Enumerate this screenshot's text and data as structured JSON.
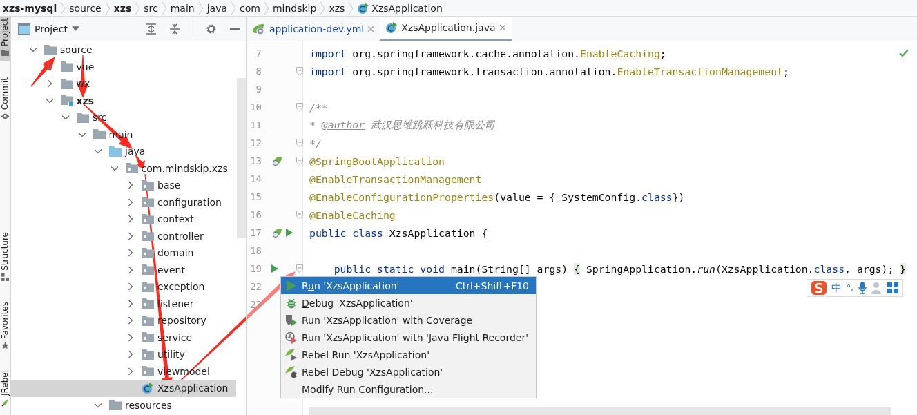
{
  "breadcrumb": [
    {
      "label": "xzs-mysql",
      "bold": true
    },
    {
      "label": "source",
      "bold": false
    },
    {
      "label": "xzs",
      "bold": true
    },
    {
      "label": "src",
      "bold": false
    },
    {
      "label": "main",
      "bold": false
    },
    {
      "label": "java",
      "bold": false
    },
    {
      "label": "com",
      "bold": false
    },
    {
      "label": "mindskip",
      "bold": false
    },
    {
      "label": "xzs",
      "bold": false
    },
    {
      "label": "XzsApplication",
      "bold": false,
      "kind": "class"
    }
  ],
  "side_tools": {
    "top": [
      {
        "label": "Project",
        "kind": "project",
        "selected": true
      },
      {
        "label": "Commit",
        "kind": "commit",
        "selected": false
      }
    ],
    "bottom": [
      {
        "label": "Structure",
        "kind": "structure",
        "selected": false
      },
      {
        "label": "Favorites",
        "kind": "favorites",
        "selected": false
      },
      {
        "label": "JRebel",
        "kind": "jrebel",
        "selected": false
      }
    ]
  },
  "project_panel": {
    "title": "Project"
  },
  "tree": [
    {
      "label": "source",
      "kind": "folder",
      "bold": false,
      "expanded": true,
      "selected": false,
      "children": [
        {
          "label": "vue",
          "kind": "folder",
          "bold": false,
          "expanded": false,
          "selected": false
        },
        {
          "label": "wx",
          "kind": "folder",
          "bold": false,
          "expanded": false,
          "selected": false
        },
        {
          "label": "xzs",
          "kind": "module",
          "bold": true,
          "expanded": true,
          "selected": false,
          "children": [
            {
              "label": "src",
              "kind": "folder",
              "bold": false,
              "expanded": true,
              "selected": false,
              "children": [
                {
                  "label": "main",
                  "kind": "folder",
                  "bold": false,
                  "expanded": true,
                  "selected": false,
                  "children": [
                    {
                      "label": "java",
                      "kind": "source-root",
                      "bold": false,
                      "expanded": true,
                      "selected": false,
                      "children": [
                        {
                          "label": "com.mindskip.xzs",
                          "kind": "package",
                          "bold": false,
                          "expanded": true,
                          "selected": false,
                          "children": [
                            {
                              "label": "base",
                              "kind": "package",
                              "bold": false,
                              "expanded": false,
                              "selected": false
                            },
                            {
                              "label": "configuration",
                              "kind": "package",
                              "bold": false,
                              "expanded": false,
                              "selected": false
                            },
                            {
                              "label": "context",
                              "kind": "package",
                              "bold": false,
                              "expanded": false,
                              "selected": false
                            },
                            {
                              "label": "controller",
                              "kind": "package",
                              "bold": false,
                              "expanded": false,
                              "selected": false
                            },
                            {
                              "label": "domain",
                              "kind": "package",
                              "bold": false,
                              "expanded": false,
                              "selected": false
                            },
                            {
                              "label": "event",
                              "kind": "package",
                              "bold": false,
                              "expanded": false,
                              "selected": false
                            },
                            {
                              "label": "exception",
                              "kind": "package",
                              "bold": false,
                              "expanded": false,
                              "selected": false
                            },
                            {
                              "label": "listener",
                              "kind": "package",
                              "bold": false,
                              "expanded": false,
                              "selected": false
                            },
                            {
                              "label": "repository",
                              "kind": "package",
                              "bold": false,
                              "expanded": false,
                              "selected": false
                            },
                            {
                              "label": "service",
                              "kind": "package",
                              "bold": false,
                              "expanded": false,
                              "selected": false
                            },
                            {
                              "label": "utility",
                              "kind": "package",
                              "bold": false,
                              "expanded": false,
                              "selected": false
                            },
                            {
                              "label": "viewmodel",
                              "kind": "package",
                              "bold": false,
                              "expanded": false,
                              "selected": false
                            },
                            {
                              "label": "XzsApplication",
                              "kind": "class",
                              "bold": false,
                              "selected": true
                            }
                          ]
                        }
                      ]
                    },
                    {
                      "label": "resources",
                      "kind": "folder",
                      "bold": false,
                      "expanded": true,
                      "selected": false
                    }
                  ]
                }
              ]
            }
          ]
        }
      ]
    }
  ],
  "tabs": [
    {
      "label": "application-dev.yml",
      "kind": "yaml",
      "selected": false,
      "modified": true
    },
    {
      "label": "XzsApplication.java",
      "kind": "class",
      "selected": true,
      "modified": false
    }
  ],
  "code": [
    {
      "number": "7",
      "tokens": [
        {
          "text": "import",
          "kind": "keyword"
        },
        {
          "text": " org.springframework.cache.annotation.",
          "kind": "plain"
        },
        {
          "text": "EnableCaching",
          "kind": "annotation"
        },
        {
          "text": ";",
          "kind": "plain"
        }
      ]
    },
    {
      "number": "8",
      "fold": true,
      "tokens": [
        {
          "text": "import",
          "kind": "keyword"
        },
        {
          "text": " org.springframework.transaction.annotation.",
          "kind": "plain"
        },
        {
          "text": "EnableTransactionManagement",
          "kind": "annotation"
        },
        {
          "text": ";",
          "kind": "plain"
        }
      ]
    },
    {
      "number": "9"
    },
    {
      "number": "10",
      "fold": true,
      "tokens": [
        {
          "text": "/**",
          "kind": "comment"
        }
      ]
    },
    {
      "number": "11",
      "tokens": [
        {
          "text": " * ",
          "kind": "comment"
        },
        {
          "text": "@author",
          "kind": "doctag"
        },
        {
          "text": " 武汉思维跳跃科技有限公司",
          "kind": "comment"
        }
      ]
    },
    {
      "number": "12",
      "fold": true,
      "tokens": [
        {
          "text": " */",
          "kind": "comment"
        }
      ]
    },
    {
      "number": "13",
      "fold": true,
      "kind": "bean",
      "tokens": [
        {
          "text": "@SpringBootApplication",
          "kind": "annotation"
        }
      ]
    },
    {
      "number": "14",
      "tokens": [
        {
          "text": "@EnableTransactionManagement",
          "kind": "annotation"
        }
      ]
    },
    {
      "number": "15",
      "tokens": [
        {
          "text": "@EnableConfigurationProperties",
          "kind": "annotation"
        },
        {
          "text": "(value = { SystemConfig.",
          "kind": "plain"
        },
        {
          "text": "class",
          "kind": "keyword"
        },
        {
          "text": "})",
          "kind": "plain"
        }
      ]
    },
    {
      "number": "16",
      "fold": true,
      "tokens": [
        {
          "text": "@EnableCaching",
          "kind": "annotation"
        }
      ]
    },
    {
      "number": "17",
      "kind": "bean-run",
      "tokens": [
        {
          "text": "public class",
          "kind": "keyword"
        },
        {
          "text": " XzsApplication {",
          "kind": "plain"
        }
      ]
    },
    {
      "number": "18"
    },
    {
      "number": "19",
      "fold": true,
      "indent": true,
      "kind": "run",
      "tokens": [
        {
          "text": "public static void",
          "kind": "keyword"
        },
        {
          "text": " main(String[] args) ",
          "kind": "plain"
        },
        {
          "text": "{",
          "kind": "brace"
        },
        {
          "text": " SpringApplication.",
          "kind": "plain"
        },
        {
          "text": "run",
          "kind": "call"
        },
        {
          "text": "(XzsApplication.",
          "kind": "plain"
        },
        {
          "text": "class",
          "kind": "keyword"
        },
        {
          "text": ", args); ",
          "kind": "plain"
        },
        {
          "text": "}",
          "kind": "brace"
        }
      ]
    },
    {
      "number": "22"
    },
    {
      "number": "23"
    }
  ],
  "context_menu": [
    {
      "kind": "run",
      "before": "R",
      "mnemonic": "u",
      "after": "n 'XzsApplication'",
      "shortcut": "Ctrl+Shift+F10",
      "selected": true
    },
    {
      "kind": "debug",
      "mnemonic": "D",
      "after": "ebug 'XzsApplication'",
      "selected": false
    },
    {
      "kind": "coverage",
      "before": "Run 'XzsApplication' with Co",
      "mnemonic": "v",
      "after": "erage",
      "selected": false
    },
    {
      "kind": "flight-recorder",
      "before": "Run 'XzsApplication' with 'Java Flight Recorder'",
      "selected": false
    },
    {
      "kind": "rebel-run",
      "before": "Rebel Run 'XzsApplication'",
      "selected": false
    },
    {
      "kind": "rebel-debug",
      "before": "Rebel Debug 'XzsApplication'",
      "selected": false
    },
    {
      "kind": "plain",
      "before": "Modify Run Configuration...",
      "selected": false
    }
  ],
  "ime_toolbar": {
    "labels": [
      "中",
      "°,"
    ]
  }
}
